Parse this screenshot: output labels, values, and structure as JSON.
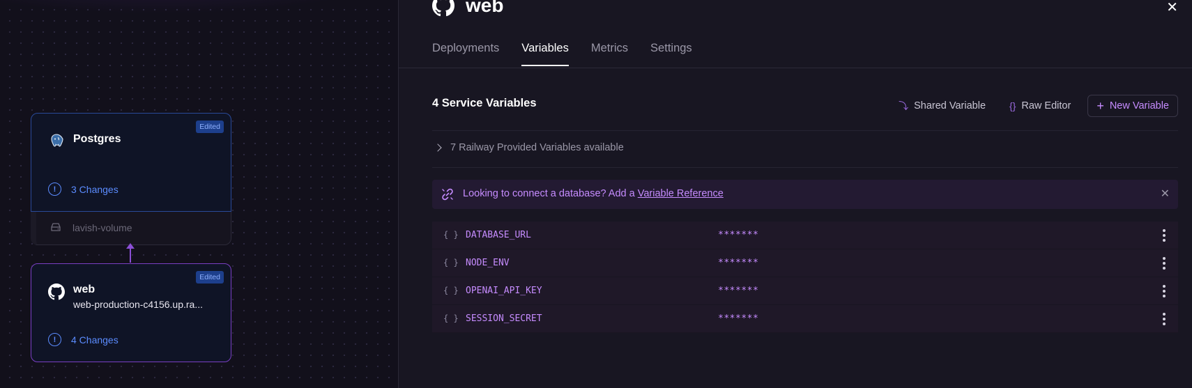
{
  "canvas": {
    "services": [
      {
        "name": "Postgres",
        "badge": "Edited",
        "changes": "3 Changes",
        "volume": "lavish-volume",
        "icon": "postgres-icon"
      },
      {
        "name": "web",
        "badge": "Edited",
        "url": "web-production-c4156.up.ra...",
        "changes": "4 Changes",
        "icon": "github-icon"
      }
    ]
  },
  "panel": {
    "title": "web",
    "close": "✕",
    "tabs": [
      {
        "label": "Deployments",
        "active": false
      },
      {
        "label": "Variables",
        "active": true
      },
      {
        "label": "Metrics",
        "active": false
      },
      {
        "label": "Settings",
        "active": false
      }
    ],
    "variables": {
      "count_label": "4 Service Variables",
      "actions": {
        "shared": "Shared Variable",
        "raw": "Raw Editor",
        "new": "New Variable"
      },
      "provided_label": "7 Railway Provided Variables available",
      "hint": {
        "text": "Looking to connect a database? Add a ",
        "link": "Variable Reference"
      },
      "rows": [
        {
          "name": "DATABASE_URL",
          "value": "*******"
        },
        {
          "name": "NODE_ENV",
          "value": "*******"
        },
        {
          "name": "OPENAI_API_KEY",
          "value": "*******"
        },
        {
          "name": "SESSION_SECRET",
          "value": "*******"
        }
      ]
    }
  },
  "colors": {
    "accent": "#c68cff",
    "blue": "#5b8cff",
    "background": "#13111c",
    "panel": "#181622"
  }
}
